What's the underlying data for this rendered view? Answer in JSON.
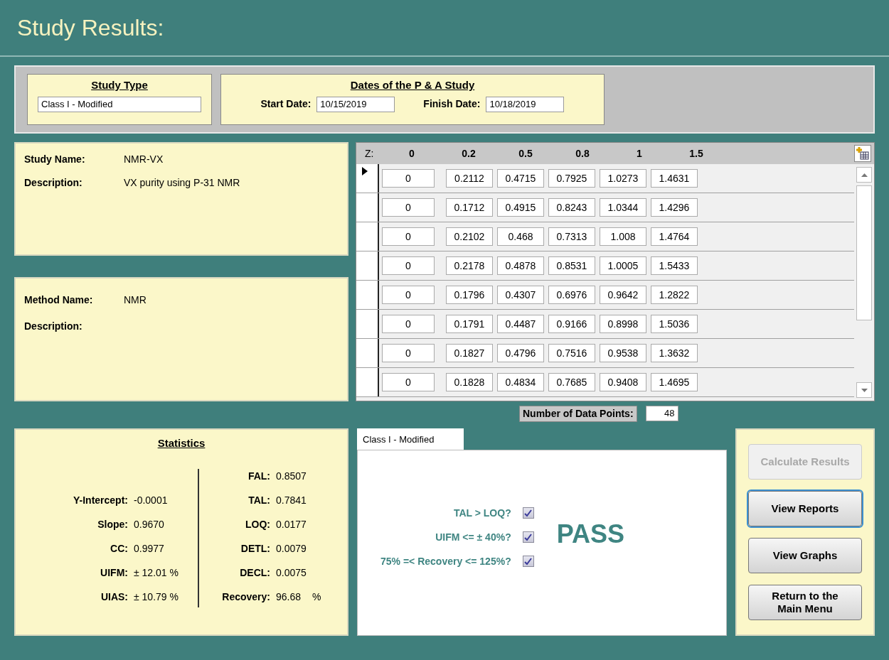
{
  "title": "Study Results:",
  "study_type": {
    "heading": "Study Type",
    "value": "Class I - Modified"
  },
  "dates": {
    "heading": "Dates of the P & A Study",
    "start_label": "Start Date:",
    "start_value": "10/15/2019",
    "finish_label": "Finish Date:",
    "finish_value": "10/18/2019"
  },
  "study": {
    "name_label": "Study Name:",
    "name_value": "NMR-VX",
    "description_label": "Description:",
    "description_value": "VX purity using P-31 NMR"
  },
  "method": {
    "name_label": "Method Name:",
    "name_value": "NMR",
    "description_label": "Description:"
  },
  "grid": {
    "z_label": "Z:",
    "columns": [
      "0",
      "0.2",
      "0.5",
      "0.8",
      "1",
      "1.5"
    ],
    "rows": [
      {
        "selected": true,
        "values": [
          "0",
          "0.2112",
          "0.4715",
          "0.7925",
          "1.0273",
          "1.4631"
        ]
      },
      {
        "selected": false,
        "values": [
          "0",
          "0.1712",
          "0.4915",
          "0.8243",
          "1.0344",
          "1.4296"
        ]
      },
      {
        "selected": false,
        "values": [
          "0",
          "0.2102",
          "0.468",
          "0.7313",
          "1.008",
          "1.4764"
        ]
      },
      {
        "selected": false,
        "values": [
          "0",
          "0.2178",
          "0.4878",
          "0.8531",
          "1.0005",
          "1.5433"
        ]
      },
      {
        "selected": false,
        "values": [
          "0",
          "0.1796",
          "0.4307",
          "0.6976",
          "0.9642",
          "1.2822"
        ]
      },
      {
        "selected": false,
        "values": [
          "0",
          "0.1791",
          "0.4487",
          "0.9166",
          "0.8998",
          "1.5036"
        ]
      },
      {
        "selected": false,
        "values": [
          "0",
          "0.1827",
          "0.4796",
          "0.7516",
          "0.9538",
          "1.3632"
        ]
      },
      {
        "selected": false,
        "values": [
          "0",
          "0.1828",
          "0.4834",
          "0.7685",
          "0.9408",
          "1.4695"
        ]
      }
    ]
  },
  "data_points": {
    "label": "Number of Data Points:",
    "value": "48"
  },
  "statistics": {
    "heading": "Statistics",
    "left": [
      {
        "label": "Y-Intercept:",
        "value": "-0.0001"
      },
      {
        "label": "Slope:",
        "value": "0.9670"
      },
      {
        "label": "CC:",
        "value": "0.9977"
      },
      {
        "label": "UIFM:",
        "value": "± 12.01 %"
      },
      {
        "label": "UIAS:",
        "value": "± 10.79 %"
      }
    ],
    "right": [
      {
        "label": "FAL:",
        "value": "0.8507"
      },
      {
        "label": "TAL:",
        "value": "0.7841"
      },
      {
        "label": "LOQ:",
        "value": "0.0177"
      },
      {
        "label": "DETL:",
        "value": "0.0079"
      },
      {
        "label": "DECL:",
        "value": "0.0075"
      },
      {
        "label": "Recovery:",
        "value": "96.68",
        "unit": "%"
      }
    ]
  },
  "tab": {
    "label": "Class I - Modified",
    "selected": true
  },
  "criteria": [
    {
      "label": "TAL > LOQ?",
      "checked": true
    },
    {
      "label": "UIFM <= ± 40%?",
      "checked": true
    },
    {
      "label": "75% =< Recovery <= 125%?",
      "checked": true
    }
  ],
  "result": "PASS",
  "buttons": [
    {
      "label": "Calculate Results",
      "disabled": true,
      "focused": false
    },
    {
      "label": "View Reports",
      "disabled": false,
      "focused": true
    },
    {
      "label": "View Graphs",
      "disabled": false,
      "focused": false
    },
    {
      "label": "Return to the Main Menu",
      "disabled": false,
      "focused": false
    }
  ]
}
